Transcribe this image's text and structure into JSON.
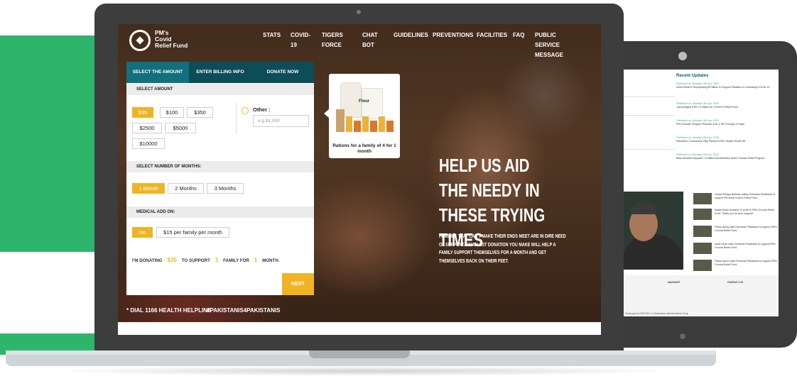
{
  "colors": {
    "accent": "#f0b323",
    "brand_teal": "#0d4d57",
    "brand_green": "#2db56b"
  },
  "logo": {
    "line1": "PM's",
    "line2": "Covid",
    "line3": "Relief Fund"
  },
  "nav": [
    {
      "label": "STATS"
    },
    {
      "label": "COVID-19"
    },
    {
      "label": "TIGERS FORCE"
    },
    {
      "label": "CHAT BOT"
    },
    {
      "label": "GUIDELINES"
    },
    {
      "label": "PREVENTIONS"
    },
    {
      "label": "FACILITIES"
    },
    {
      "label": "FAQ"
    },
    {
      "label": "PUBLIC SERVICE MESSAGE"
    }
  ],
  "form": {
    "steps": [
      "SELECT THE AMOUNT",
      "ENTER BILLING INFO",
      "DONATE NOW"
    ],
    "select_amount_title": "SELECT AMOUNT",
    "amounts": [
      "$35",
      "$100",
      "$350",
      "$2500",
      "$5000",
      "$10000"
    ],
    "other_label": "Other :",
    "other_placeholder": "e.g $1,000",
    "months_title": "SELECT NUMBER OF MONTHS:",
    "months": [
      "1 Month",
      "2 Months",
      "3 Months"
    ],
    "medical_title": "MEDICAL ADD ON:",
    "medical_options": [
      "No",
      "$15 per family per month"
    ],
    "summary": {
      "p1": "I'M DONATING",
      "amount": "$35",
      "p2": "TO SUPPORT",
      "families": "1",
      "p3": "FAMILY FOR",
      "months": "1",
      "p4": "MONTH."
    },
    "next_label": "NEXT"
  },
  "ration_card": {
    "caption": "Rations for a family of 4 for 1 month",
    "sack_label": "Flour"
  },
  "hero": {
    "title": "HELP US AID THE NEEDY IN THESE TRYING TIMES",
    "subtitle": "FAMILIES THAT CAN'T MAKE THEIR ENDS MEET ARE IN DIRE NEED OF SUPPORT. SMALLEST DONATION YOU MAKE WILL HELP A FAMILY SUPPORT THEMSELVES FOR A MONTH AND GET THEMSELVES BACK ON THEIR FEET."
  },
  "footer": {
    "helpline": "* DIAL 1166 HEALTH HELPLINE",
    "hashtag": "#PAKISTANIS4PAKISTANIS"
  },
  "secondary_screen": {
    "recent_updates_title": "Recent Updates",
    "updates": [
      {
        "date": "Published on: Monday 13th Apr, 2020",
        "text": "World Bank is Repurposing $2 Billion to Support Pakistan to Combating COVID-19"
      },
      {
        "date": "Published on: Monday 13th Apr, 2020",
        "text": "Jazz pledged PKR 1.2 Billion for COVID19 Relief Fund"
      },
      {
        "date": "Published on: Monday 13th Apr, 2020",
        "text": "PM's Ehsaas Program Reaches AJK & GB Through 3-Pakss"
      },
      {
        "date": "Published on: Monday 13th Apr, 2020",
        "text": "Pakistan's Coronavirus Tally Passes 5,000; Deaths Reach 86"
      },
      {
        "date": "Published on: Monday 13th Apr, 2020",
        "text": "Bank AlHabib Supports 1.5 Million Beneficiaries Under Ehsaas Relief Program"
      }
    ],
    "videos": [
      "Zoyad Zulfiqar Bukhari calling Overseas Pakistanis to support PM Imran Khan's Relief Fund.",
      "Zaalal Munir donated 10 crore to PM's Corona Relief Fund. Thank you for your support!",
      "Firdos Ashiq calls Overseas Pakistanis to support PM's Corona Relief Fund.",
      "Asad Umar calls Overseas Pakistanis to support PM's Corona Relief Fund.",
      "Faisal Javed calls Overseas Pakistanis to support PM's Corona Relief Fund."
    ],
    "footer_navigate": "NAVIGATE",
    "footer_contact": "CONTACT US",
    "developed_by": "Developed by NOPHRD in Collaboration with Interactive Group"
  }
}
